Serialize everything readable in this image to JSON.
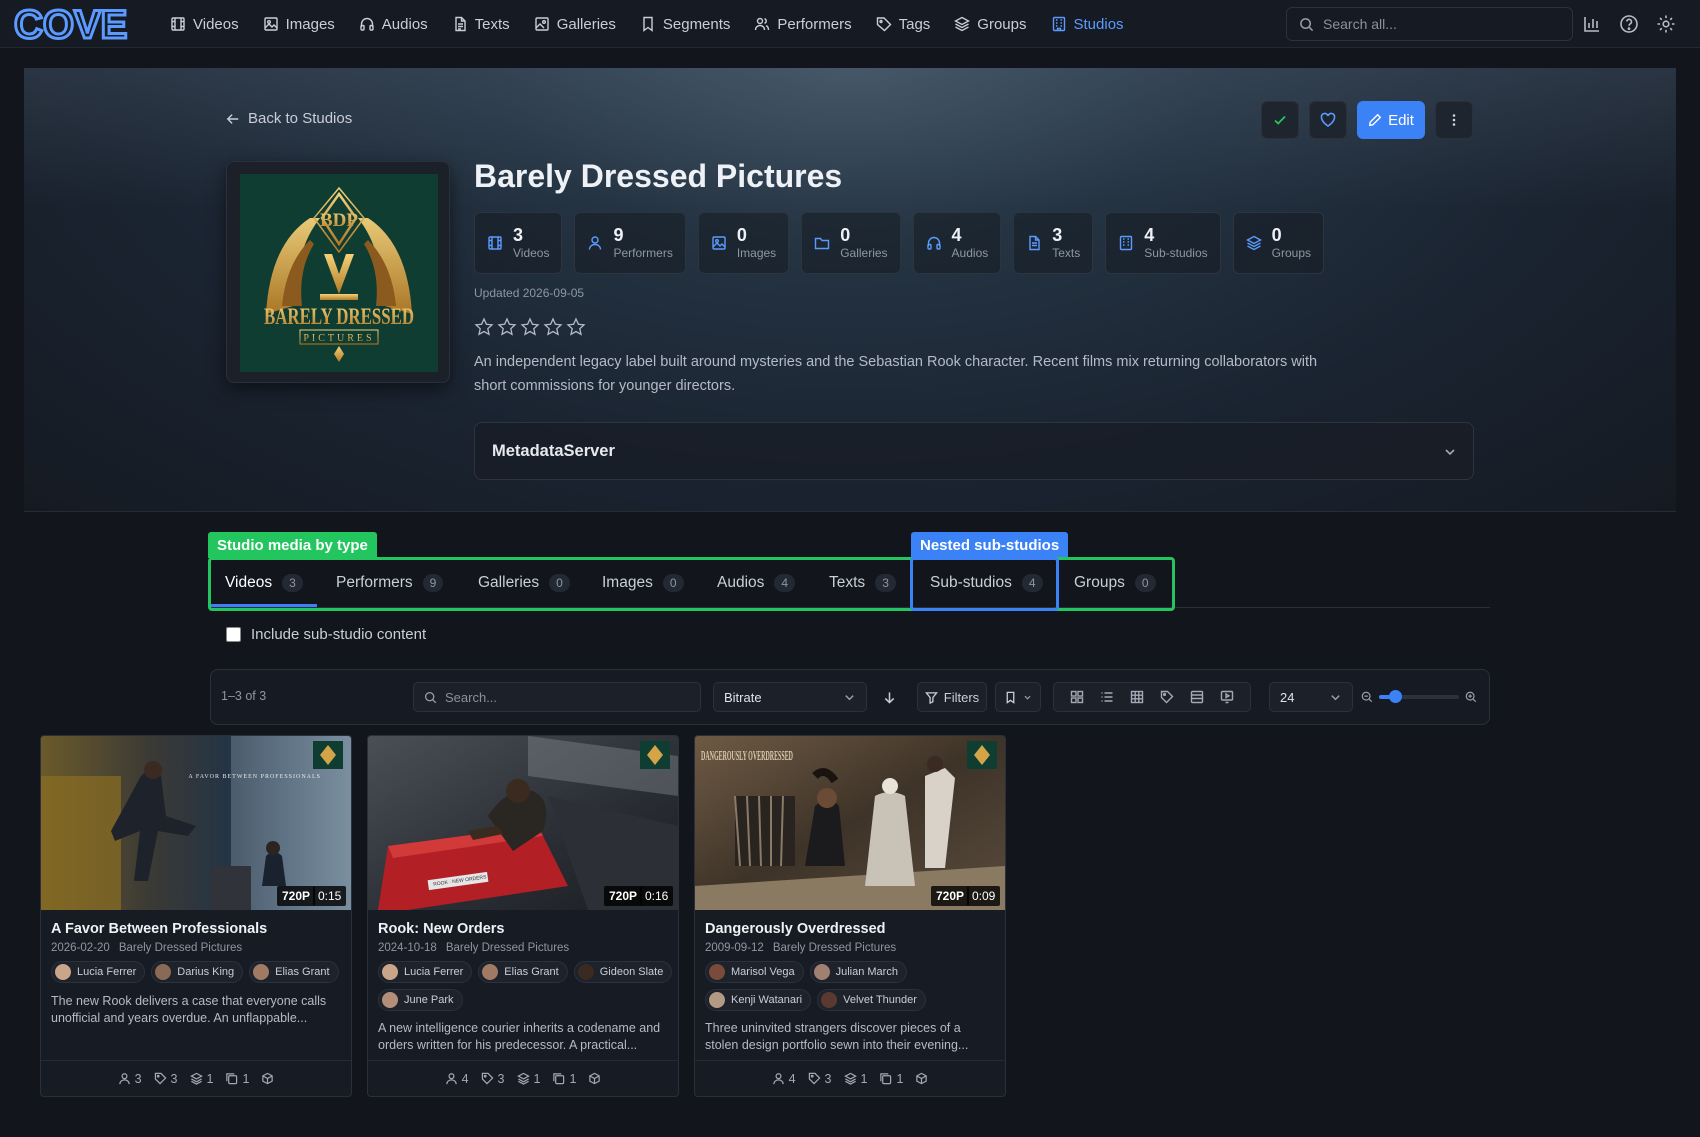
{
  "brand": {
    "logo_text": "COVE"
  },
  "nav": {
    "items": [
      {
        "label": "Videos",
        "icon": "film-icon"
      },
      {
        "label": "Images",
        "icon": "image-icon"
      },
      {
        "label": "Audios",
        "icon": "headphones-icon"
      },
      {
        "label": "Texts",
        "icon": "file-text-icon"
      },
      {
        "label": "Galleries",
        "icon": "gallery-icon"
      },
      {
        "label": "Segments",
        "icon": "bookmark-icon"
      },
      {
        "label": "Performers",
        "icon": "users-icon"
      },
      {
        "label": "Tags",
        "icon": "tag-icon"
      },
      {
        "label": "Groups",
        "icon": "layers-icon"
      },
      {
        "label": "Studios",
        "icon": "building-icon"
      }
    ],
    "active": "Studios",
    "search_placeholder": "Search all..."
  },
  "header": {
    "back_label": "Back to Studios",
    "edit_label": "Edit",
    "studio_name": "Barely Dressed Pictures",
    "updated": "Updated 2026-09-05",
    "rating_stars": 0,
    "rating_max": 5,
    "description": "An independent legacy label built around mysteries and the Sebastian Rook character. Recent films mix returning collaborators with short commissions for younger directors.",
    "metadata_title": "MetadataServer",
    "logo": {
      "monogram": "BDP",
      "line1": "BARELY DRESSED",
      "line2": "PICTURES"
    }
  },
  "stats": [
    {
      "num": "3",
      "label": "Videos",
      "icon": "film-icon"
    },
    {
      "num": "9",
      "label": "Performers",
      "icon": "user-icon"
    },
    {
      "num": "0",
      "label": "Images",
      "icon": "image-icon"
    },
    {
      "num": "0",
      "label": "Galleries",
      "icon": "folder-icon"
    },
    {
      "num": "4",
      "label": "Audios",
      "icon": "headphones-icon"
    },
    {
      "num": "3",
      "label": "Texts",
      "icon": "file-text-icon"
    },
    {
      "num": "4",
      "label": "Sub-studios",
      "icon": "building-icon"
    },
    {
      "num": "0",
      "label": "Groups",
      "icon": "layers-icon"
    }
  ],
  "annotations": {
    "green_label": "Studio media by type",
    "blue_label": "Nested sub-studios"
  },
  "tabs": [
    {
      "label": "Videos",
      "count": "3"
    },
    {
      "label": "Performers",
      "count": "9"
    },
    {
      "label": "Galleries",
      "count": "0"
    },
    {
      "label": "Images",
      "count": "0"
    },
    {
      "label": "Audios",
      "count": "4"
    },
    {
      "label": "Texts",
      "count": "3"
    },
    {
      "label": "Sub-studios",
      "count": "4"
    },
    {
      "label": "Groups",
      "count": "0"
    }
  ],
  "include_sub_label": "Include sub-studio content",
  "toolbar": {
    "count": "1–3 of 3",
    "search_placeholder": "Search...",
    "sort": "Bitrate",
    "filters_label": "Filters",
    "per_page": "24",
    "zoom_fraction": 0.2
  },
  "cards": [
    {
      "title": "A Favor Between Professionals",
      "date": "2026-02-20",
      "studio": "Barely Dressed Pictures",
      "resolution": "720P",
      "duration": "0:15",
      "performers": [
        "Lucia Ferrer",
        "Darius King",
        "Elias Grant"
      ],
      "description": "The new Rook delivers a case that everyone calls unofficial and years overdue. An unflappable...",
      "counts": {
        "performers": "3",
        "tags": "3",
        "groups": "1",
        "galleries": "1"
      },
      "poster_text": "A FAVOR BETWEEN PROFESSIONALS"
    },
    {
      "title": "Rook: New Orders",
      "date": "2024-10-18",
      "studio": "Barely Dressed Pictures",
      "resolution": "720P",
      "duration": "0:16",
      "performers": [
        "Lucia Ferrer",
        "Elias Grant",
        "Gideon Slate",
        "June Park"
      ],
      "description": "A new intelligence courier inherits a codename and orders written for his predecessor. A practical...",
      "counts": {
        "performers": "4",
        "tags": "3",
        "groups": "1",
        "galleries": "1"
      },
      "poster_text": "ROOK · NEW ORDERS"
    },
    {
      "title": "Dangerously Overdressed",
      "date": "2009-09-12",
      "studio": "Barely Dressed Pictures",
      "resolution": "720P",
      "duration": "0:09",
      "performers": [
        "Marisol Vega",
        "Julian March",
        "Kenji Watanari",
        "Velvet Thunder"
      ],
      "description": "Three uninvited strangers discover pieces of a stolen design portfolio sewn into their evening...",
      "counts": {
        "performers": "4",
        "tags": "3",
        "groups": "1",
        "galleries": "1"
      },
      "poster_text": "DANGEROUSLY OVERDRESSED"
    }
  ],
  "colors": {
    "accent": "#3b82f6",
    "annotation_green": "#22c55e",
    "logo_gold": "#d4a447",
    "logo_bg": "#0f3d31"
  }
}
